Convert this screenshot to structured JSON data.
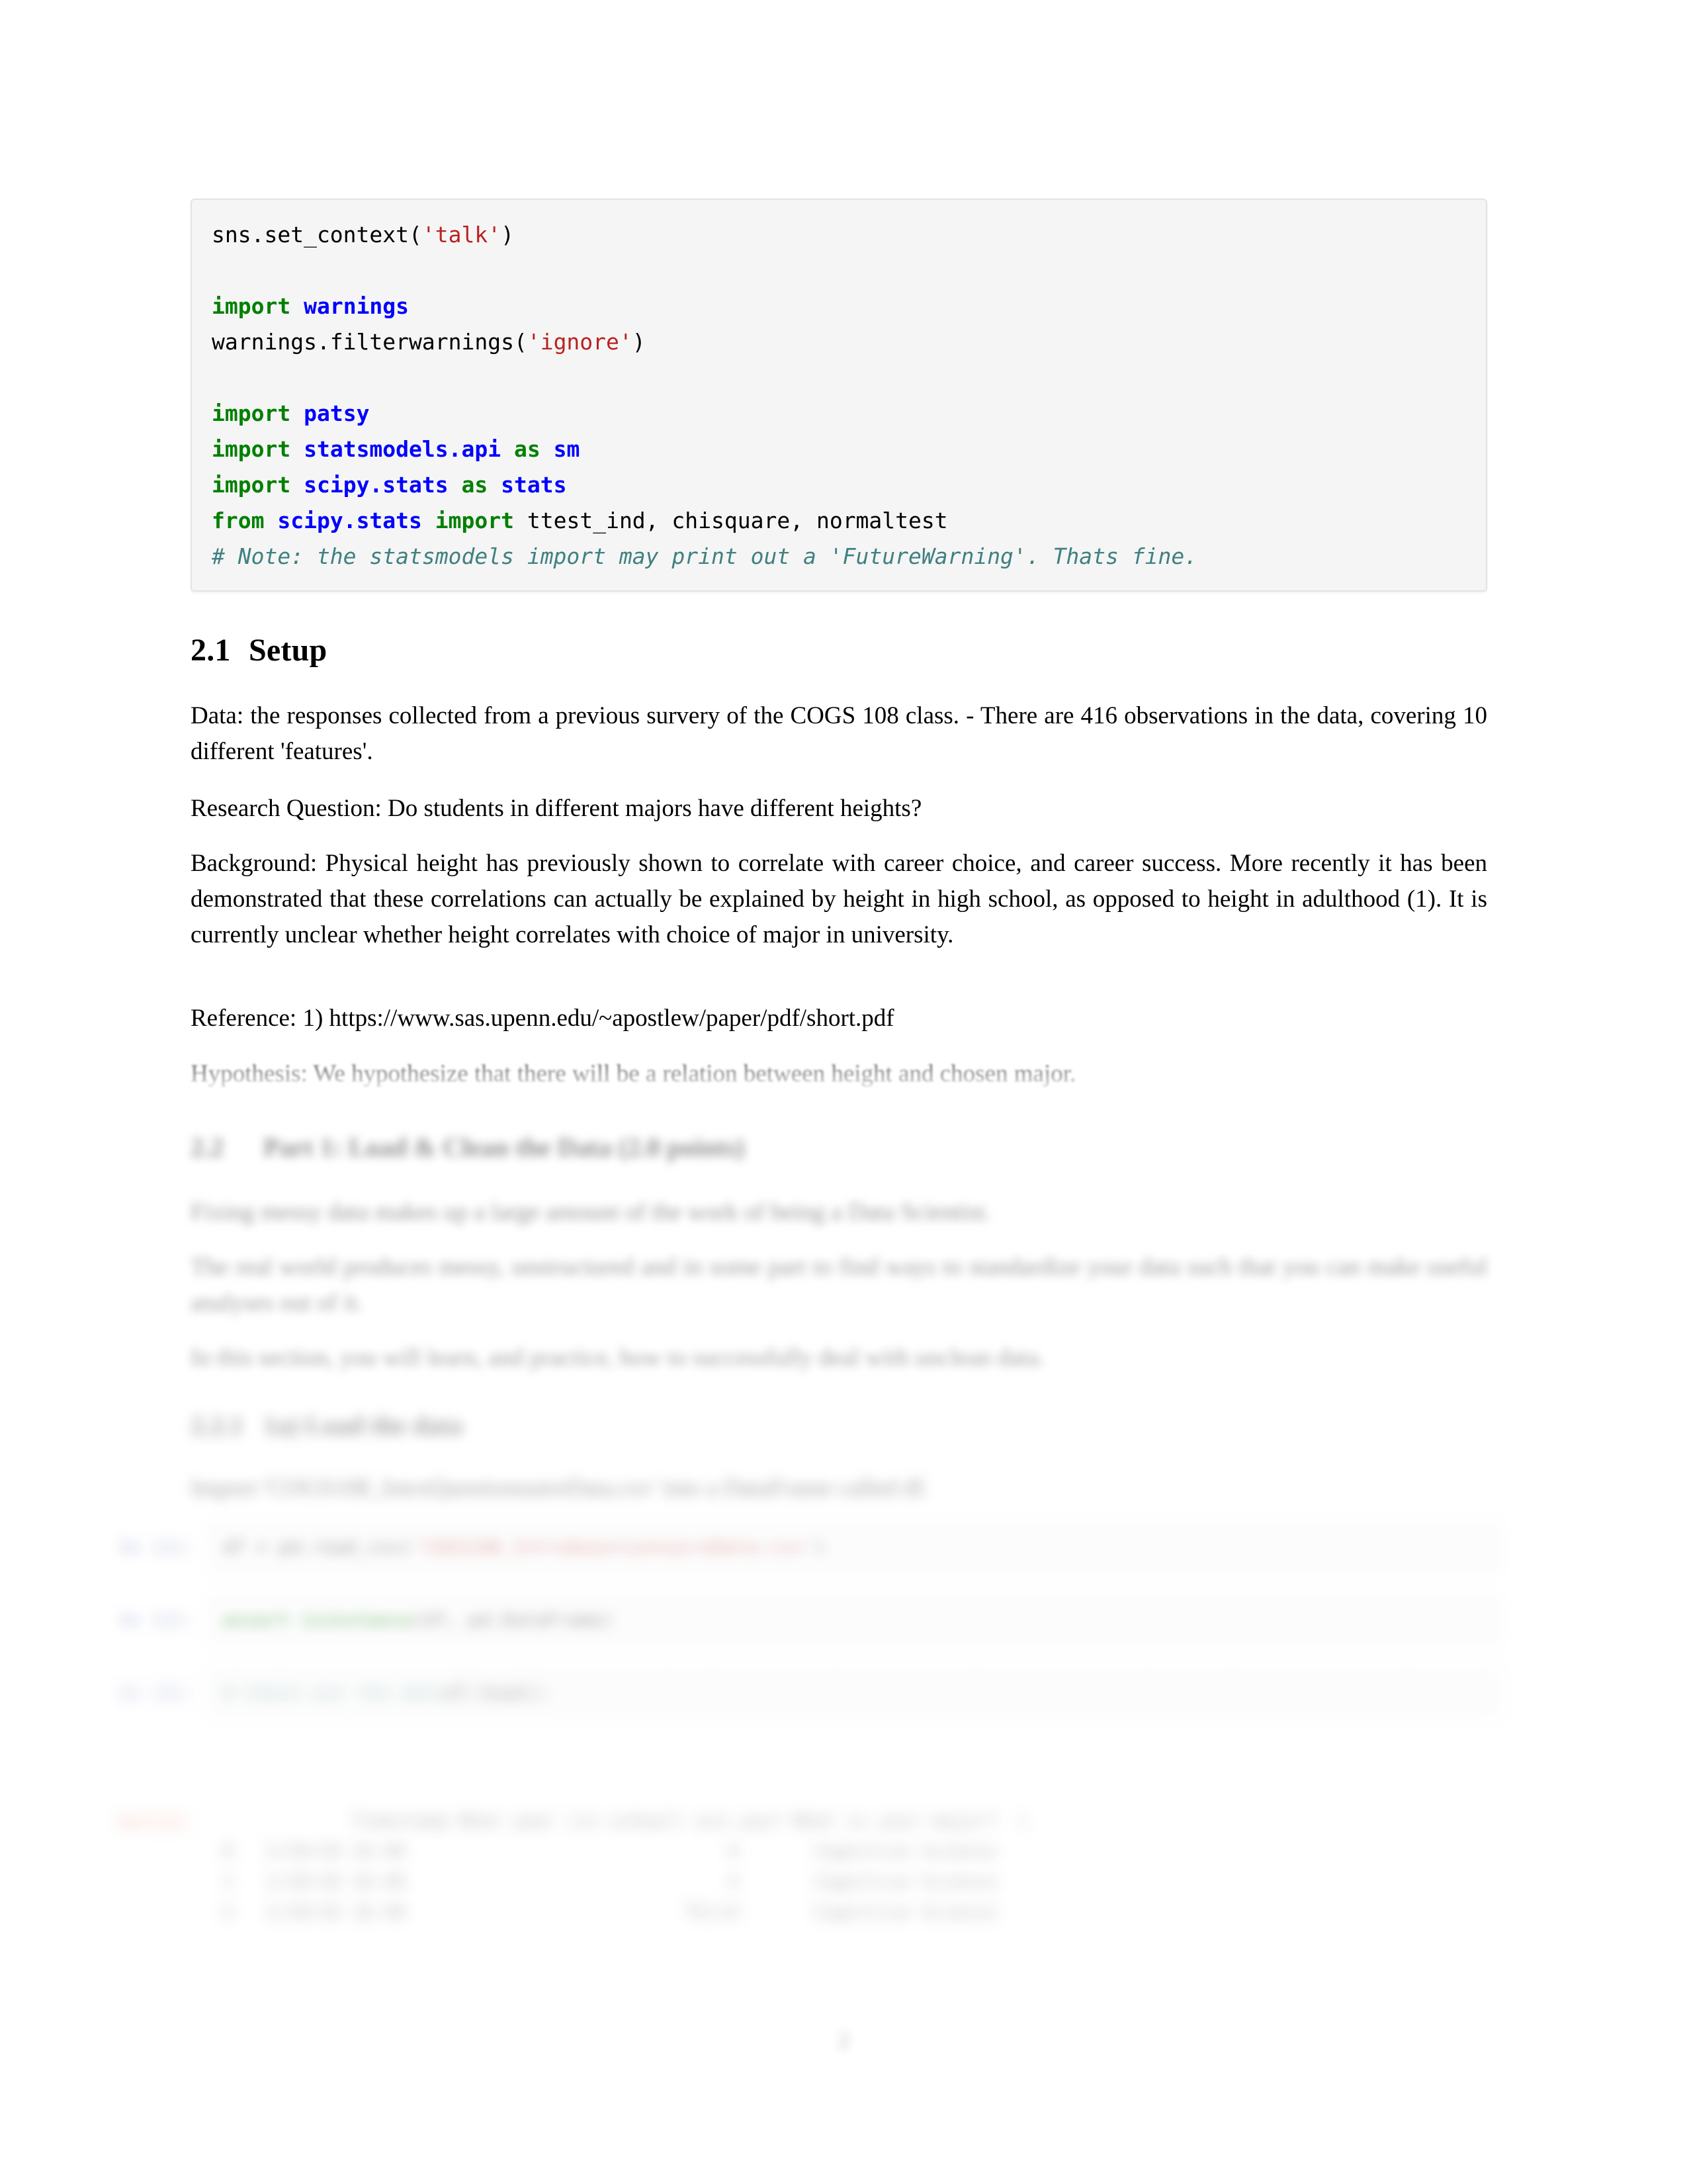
{
  "document": {
    "page_number": "2",
    "code_cell": {
      "lines": [
        [
          {
            "t": "sns.set_context(",
            "c": "pln"
          },
          {
            "t": "'talk'",
            "c": "str"
          },
          {
            "t": ")",
            "c": "pln"
          }
        ],
        [],
        [
          {
            "t": "import",
            "c": "kw"
          },
          {
            "t": " ",
            "c": "pln"
          },
          {
            "t": "warnings",
            "c": "nm"
          }
        ],
        [
          {
            "t": "warnings.filterwarnings(",
            "c": "pln"
          },
          {
            "t": "'ignore'",
            "c": "str"
          },
          {
            "t": ")",
            "c": "pln"
          }
        ],
        [],
        [
          {
            "t": "import",
            "c": "kw"
          },
          {
            "t": " ",
            "c": "pln"
          },
          {
            "t": "patsy",
            "c": "nm"
          }
        ],
        [
          {
            "t": "import",
            "c": "kw"
          },
          {
            "t": " ",
            "c": "pln"
          },
          {
            "t": "statsmodels.api",
            "c": "nm"
          },
          {
            "t": " ",
            "c": "pln"
          },
          {
            "t": "as",
            "c": "kw"
          },
          {
            "t": " ",
            "c": "pln"
          },
          {
            "t": "sm",
            "c": "nm"
          }
        ],
        [
          {
            "t": "import",
            "c": "kw"
          },
          {
            "t": " ",
            "c": "pln"
          },
          {
            "t": "scipy.stats",
            "c": "nm"
          },
          {
            "t": " ",
            "c": "pln"
          },
          {
            "t": "as",
            "c": "kw"
          },
          {
            "t": " ",
            "c": "pln"
          },
          {
            "t": "stats",
            "c": "nm"
          }
        ],
        [
          {
            "t": "from",
            "c": "kw"
          },
          {
            "t": " ",
            "c": "pln"
          },
          {
            "t": "scipy.stats",
            "c": "nm"
          },
          {
            "t": " ",
            "c": "pln"
          },
          {
            "t": "import",
            "c": "kw"
          },
          {
            "t": " ttest_ind, chisquare, normaltest",
            "c": "pln"
          }
        ],
        [
          {
            "t": "# Note: the statsmodels import may print out a 'FutureWarning'. Thats fine.",
            "c": "cmt"
          }
        ]
      ]
    },
    "section_setup": {
      "number": "2.1",
      "title": "Setup",
      "paragraphs": [
        "Data: the responses collected from a previous survery of the COGS 108 class. - There are 416 observations in the data, covering 10 different 'features'.",
        "Research Question: Do students in different majors have different heights?",
        "Background: Physical height has previously shown to correlate with career choice, and career success. More recently it has been demonstrated that these correlations can actually be explained by height in high school, as opposed to height in adulthood (1). It is currently unclear whether height correlates with choice of major in university.",
        "Reference: 1) https://www.sas.upenn.edu/~apostlew/paper/pdf/short.pdf",
        "Hypothesis: We hypothesize that there will be a relation between height and chosen major."
      ]
    },
    "section_part1": {
      "number": "2.2",
      "title": "Part 1: Load & Clean the Data (2.0 points)",
      "paragraphs": [
        "Fixing messy data makes up a large amount of the work of being a Data Scientist.",
        "The real world produces messy, unstructured and in some part to find ways to standardize your data such that you can make useful analyses out of it.",
        "In this section, you will learn, and practice, how to successfully deal with unclean data."
      ]
    },
    "subsection_load": {
      "number": "2.2.1",
      "title": "1a) Load the data",
      "paragraphs": [
        "Import 'COGS108_IntroQuestionnaireData.csv' into a DataFrame called df."
      ]
    },
    "cells": [
      {
        "prompt": "In [1]:",
        "prompt_kind": "in",
        "lines": [
          [
            {
              "t": "df ",
              "c": "pln"
            },
            {
              "t": "= ",
              "c": "pln"
            },
            {
              "t": "pd.read_csv(",
              "c": "pln"
            },
            {
              "t": "'COGS108_IntroQuestionnaireData.csv'",
              "c": "str"
            },
            {
              "t": ")",
              "c": "pln"
            }
          ]
        ]
      },
      {
        "prompt": "In [2]:",
        "prompt_kind": "in",
        "lines": [
          [
            {
              "t": "assert",
              "c": "kw"
            },
            {
              "t": " ",
              "c": "pln"
            },
            {
              "t": "isinstance",
              "c": "kw"
            },
            {
              "t": "(df, pd.DataFrame)",
              "c": "pln"
            }
          ]
        ]
      },
      {
        "prompt": "In [3]:",
        "prompt_kind": "in",
        "lines": [
          [
            {
              "t": "# Check out the data",
              "c": "cmt"
            }
          ],
          [
            {
              "t": "df.head()",
              "c": "pln"
            }
          ]
        ]
      },
      {
        "prompt": "Out[3]:",
        "prompt_kind": "out",
        "table_lines": [
          "            Timestamp What year (in school) are you? What is your major?  \\",
          "0   1/10/18 16:40                              4       Cognitive Science",
          "1   1/10/18 16:40                              4       Cognitive Science",
          "2   1/10/18 16:40                          Third       Cognitive Science"
        ]
      }
    ]
  }
}
